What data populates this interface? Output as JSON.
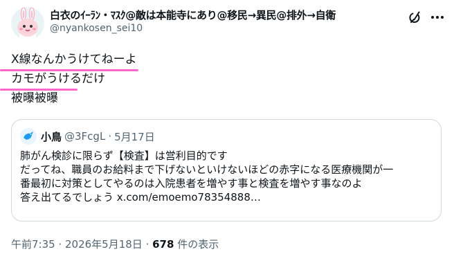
{
  "post": {
    "display_name": "白衣のｲｰﾗﾝ・ﾏｽｸ@敵は本能寺にあり@移民→異民@排外→自衛",
    "handle": "@nyankosen_sei10",
    "body_lines": [
      "X線なんかうけてねーよ",
      "カモがうけるだけ",
      "被曝被曝"
    ]
  },
  "quote": {
    "name": "小鳥",
    "handle": "@3FcgL",
    "separator": "·",
    "date": "5月17日",
    "lines": [
      "肺がん検診に限らず【検査】は営利目的です",
      "だってね、職員のお給料まで下げないといけないほどの赤字になる医療機関が一",
      "番最初に対策としてやるのは入院患者を増やす事と検査を増やす事なのよ",
      "答え出てるでしょう x.com/emoemo78354888…"
    ]
  },
  "meta": {
    "time": "午前7:35",
    "separator": " · ",
    "date": "2026年5月18日",
    "views": "678",
    "views_label": " 件の表示"
  },
  "colors": {
    "highlight": "#ff66cc",
    "muted": "#536471",
    "border": "#cfd9de"
  },
  "icons": [
    "grok-icon",
    "more-icon",
    "avatar-rabbit",
    "dove-avatar"
  ]
}
